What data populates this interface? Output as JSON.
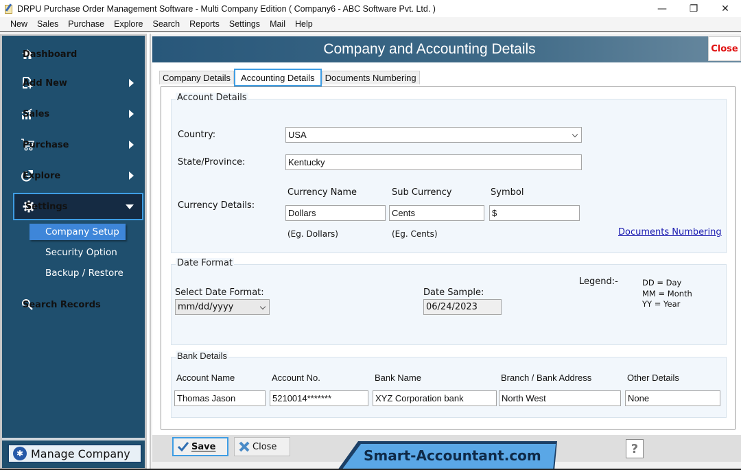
{
  "window": {
    "title": "DRPU Purchase Order Management Software - Multi Company Edition ( Company6 - ABC Software Pvt. Ltd. )",
    "controls": {
      "minimize": "—",
      "restore": "❐",
      "close": "✕"
    }
  },
  "menubar": [
    "New",
    "Sales",
    "Purchase",
    "Explore",
    "Search",
    "Reports",
    "Settings",
    "Mail",
    "Help"
  ],
  "sidebar": {
    "items": [
      {
        "label": "Dashboard",
        "icon": "home-icon"
      },
      {
        "label": "Add New",
        "icon": "add-document-icon"
      },
      {
        "label": "Sales",
        "icon": "chart-icon"
      },
      {
        "label": "Purchase",
        "icon": "cart-icon"
      },
      {
        "label": "Explore",
        "icon": "explore-icon"
      },
      {
        "label": "Settings",
        "icon": "gear-icon"
      },
      {
        "label": "Search Records",
        "icon": "search-icon"
      }
    ],
    "settings_sub": [
      "Company Setup",
      "Security Option",
      "Backup / Restore"
    ],
    "manage_company": "Manage Company"
  },
  "main": {
    "title": "Company and Accounting Details",
    "close_label": "Close",
    "tabs": [
      "Company Details",
      "Accounting Details",
      "Documents Numbering"
    ],
    "active_tab": "Accounting Details",
    "account_details": {
      "legend": "Account Details",
      "country_label": "Country:",
      "country_value": "USA",
      "state_label": "State/Province:",
      "state_value": "Kentucky",
      "currency_label": "Currency Details:",
      "currency_name_label": "Currency Name",
      "currency_name_value": "Dollars",
      "currency_name_hint": "(Eg. Dollars)",
      "sub_currency_label": "Sub Currency",
      "sub_currency_value": "Cents",
      "sub_currency_hint": "(Eg. Cents)",
      "symbol_label": "Symbol",
      "symbol_value": "$",
      "documents_link": "Documents Numbering"
    },
    "date_format": {
      "legend": "Date Format",
      "select_label": "Select Date Format:",
      "select_value": "mm/dd/yyyy",
      "sample_label": "Date Sample:",
      "sample_value": "06/24/2023",
      "legend_label": "Legend:-",
      "legend_items": [
        "DD = Day",
        "MM = Month",
        "YY = Year"
      ]
    },
    "bank_details": {
      "legend": "Bank Details",
      "account_name_label": "Account Name",
      "account_name_value": "Thomas Jason",
      "account_no_label": "Account No.",
      "account_no_value": "5210014*******",
      "bank_name_label": "Bank Name",
      "bank_name_value": "XYZ Corporation bank",
      "branch_label": "Branch / Bank Address",
      "branch_value": "North West",
      "other_label": "Other Details",
      "other_value": "None"
    },
    "footer": {
      "save_label": "Save",
      "close_label": "Close",
      "brand": "Smart-Accountant.com",
      "help": "?"
    }
  },
  "colors": {
    "sidebar_bg": "#1f4f6e",
    "accent": "#3e9de4",
    "header_close": "#e01010",
    "link": "#1a1ab0"
  }
}
